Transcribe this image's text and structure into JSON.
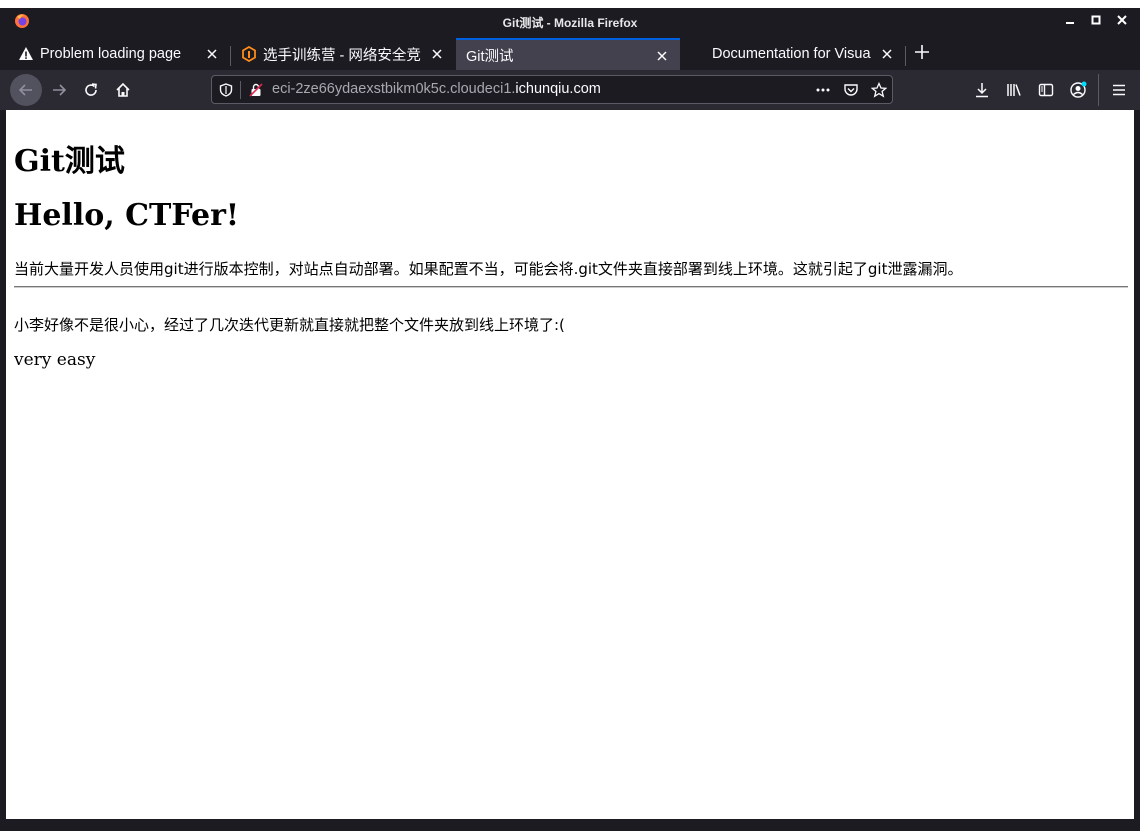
{
  "window": {
    "title": "Git测试 - Mozilla Firefox"
  },
  "tabs": [
    {
      "label": "Problem loading page",
      "icon": "warning-icon"
    },
    {
      "label": "选手训练营 - 网络安全竞",
      "icon": "ichunqiu-icon"
    },
    {
      "label": "Git测试",
      "active": true
    },
    {
      "label": "Documentation for Visua"
    }
  ],
  "urlbar": {
    "url_dim": "eci-2ze66ydaexstbikm0k5c.cloudeci1.",
    "url_main": "ichunqiu.com"
  },
  "page": {
    "h1": "Git测试",
    "h2": "Hello, CTFer!",
    "intro": "当前大量开发人员使用git进行版本控制，对站点自动部署。如果配置不当，可能会将.git文件夹直接部署到线上环境。这就引起了git泄露漏洞。",
    "note": "小李好像不是很小心，经过了几次迭代更新就直接就把整个文件夹放到线上环境了:(",
    "hint": "very easy"
  },
  "colors": {
    "chrome_bg": "#1c1b22",
    "toolbar_bg": "#2b2a33",
    "active_tab": "#42414d",
    "accent": "#0060df"
  }
}
